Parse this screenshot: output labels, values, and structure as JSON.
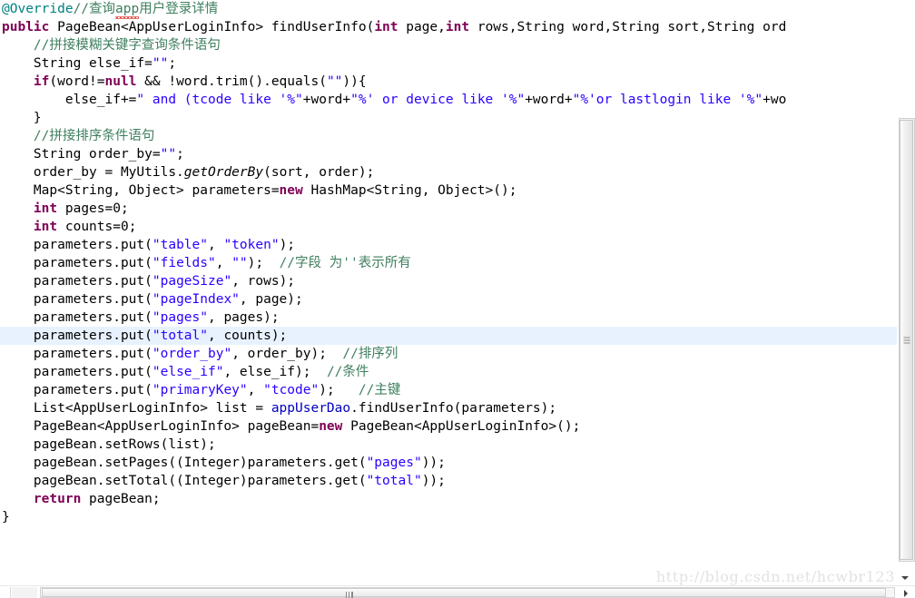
{
  "editor": {
    "language": "java",
    "colors": {
      "keyword": "#7F0055",
      "string": "#2A00FF",
      "comment": "#3F7F5F",
      "annotation": "#646464",
      "field": "#0000C0",
      "current_line_highlight": "#E8F2FE",
      "background": "#FFFFFF",
      "foreground": "#000000"
    },
    "current_line_index": 20,
    "lines": [
      {
        "index": 0,
        "indent": 0,
        "highlighted": false,
        "tokens": [
          {
            "t": "annotation",
            "v": "@Override"
          },
          {
            "t": "comment",
            "v": "//查询"
          },
          {
            "t": "comment-misspelled",
            "v": "app"
          },
          {
            "t": "comment",
            "v": "用户登录详情"
          }
        ]
      },
      {
        "index": 1,
        "indent": 0,
        "highlighted": false,
        "tokens": [
          {
            "t": "keyword",
            "v": "public"
          },
          {
            "t": "plain",
            "v": " PageBean<AppUserLoginInfo> findUserInfo("
          },
          {
            "t": "keyword",
            "v": "int"
          },
          {
            "t": "plain",
            "v": " page,"
          },
          {
            "t": "keyword",
            "v": "int"
          },
          {
            "t": "plain",
            "v": " rows,String word,String sort,String ord"
          }
        ]
      },
      {
        "index": 2,
        "indent": 1,
        "highlighted": false,
        "tokens": [
          {
            "t": "comment",
            "v": "//拼接模糊关键字查询条件语句"
          }
        ]
      },
      {
        "index": 3,
        "indent": 1,
        "highlighted": false,
        "tokens": [
          {
            "t": "plain",
            "v": "String else_if="
          },
          {
            "t": "string",
            "v": "\"\""
          },
          {
            "t": "plain",
            "v": ";"
          }
        ]
      },
      {
        "index": 4,
        "indent": 1,
        "highlighted": false,
        "tokens": [
          {
            "t": "keyword",
            "v": "if"
          },
          {
            "t": "plain",
            "v": "(word!="
          },
          {
            "t": "keyword",
            "v": "null"
          },
          {
            "t": "plain",
            "v": " && !word.trim().equals("
          },
          {
            "t": "string",
            "v": "\"\""
          },
          {
            "t": "plain",
            "v": ")){"
          }
        ]
      },
      {
        "index": 5,
        "indent": 2,
        "highlighted": false,
        "tokens": [
          {
            "t": "plain",
            "v": "else_if+="
          },
          {
            "t": "string",
            "v": "\" and (tcode like '%\""
          },
          {
            "t": "plain",
            "v": "+word+"
          },
          {
            "t": "string",
            "v": "\"%' or device like '%\""
          },
          {
            "t": "plain",
            "v": "+word+"
          },
          {
            "t": "string",
            "v": "\"%'or lastlogin like '%\""
          },
          {
            "t": "plain",
            "v": "+wo"
          }
        ]
      },
      {
        "index": 6,
        "indent": 1,
        "highlighted": false,
        "tokens": [
          {
            "t": "plain",
            "v": "}"
          }
        ]
      },
      {
        "index": 7,
        "indent": 1,
        "highlighted": false,
        "tokens": [
          {
            "t": "comment",
            "v": "//拼接排序条件语句"
          }
        ]
      },
      {
        "index": 8,
        "indent": 1,
        "highlighted": false,
        "tokens": [
          {
            "t": "plain",
            "v": "String order_by="
          },
          {
            "t": "string",
            "v": "\"\""
          },
          {
            "t": "plain",
            "v": ";"
          }
        ]
      },
      {
        "index": 9,
        "indent": 1,
        "highlighted": false,
        "tokens": [
          {
            "t": "plain",
            "v": "order_by = MyUtils."
          },
          {
            "t": "static-method",
            "v": "getOrderBy"
          },
          {
            "t": "plain",
            "v": "(sort, order);"
          }
        ]
      },
      {
        "index": 10,
        "indent": 1,
        "highlighted": false,
        "tokens": [
          {
            "t": "plain",
            "v": "Map<String, Object> parameters="
          },
          {
            "t": "keyword",
            "v": "new"
          },
          {
            "t": "plain",
            "v": " HashMap<String, Object>();"
          }
        ]
      },
      {
        "index": 11,
        "indent": 1,
        "highlighted": false,
        "tokens": [
          {
            "t": "keyword",
            "v": "int"
          },
          {
            "t": "plain",
            "v": " pages=0;"
          }
        ]
      },
      {
        "index": 12,
        "indent": 1,
        "highlighted": false,
        "tokens": [
          {
            "t": "keyword",
            "v": "int"
          },
          {
            "t": "plain",
            "v": " counts=0;"
          }
        ]
      },
      {
        "index": 13,
        "indent": 1,
        "highlighted": false,
        "tokens": [
          {
            "t": "plain",
            "v": "parameters.put("
          },
          {
            "t": "string",
            "v": "\"table\""
          },
          {
            "t": "plain",
            "v": ", "
          },
          {
            "t": "string",
            "v": "\"token\""
          },
          {
            "t": "plain",
            "v": ");"
          }
        ]
      },
      {
        "index": 14,
        "indent": 1,
        "highlighted": false,
        "tokens": [
          {
            "t": "plain",
            "v": "parameters.put("
          },
          {
            "t": "string",
            "v": "\"fields\""
          },
          {
            "t": "plain",
            "v": ", "
          },
          {
            "t": "string",
            "v": "\"\""
          },
          {
            "t": "plain",
            "v": ");  "
          },
          {
            "t": "comment",
            "v": "//字段 为''表示所有"
          }
        ]
      },
      {
        "index": 15,
        "indent": 1,
        "highlighted": false,
        "tokens": [
          {
            "t": "plain",
            "v": "parameters.put("
          },
          {
            "t": "string",
            "v": "\"pageSize\""
          },
          {
            "t": "plain",
            "v": ", rows);"
          }
        ]
      },
      {
        "index": 16,
        "indent": 1,
        "highlighted": false,
        "tokens": [
          {
            "t": "plain",
            "v": "parameters.put("
          },
          {
            "t": "string",
            "v": "\"pageIndex\""
          },
          {
            "t": "plain",
            "v": ", page);"
          }
        ]
      },
      {
        "index": 17,
        "indent": 1,
        "highlighted": false,
        "tokens": [
          {
            "t": "plain",
            "v": "parameters.put("
          },
          {
            "t": "string",
            "v": "\"pages\""
          },
          {
            "t": "plain",
            "v": ", pages);"
          }
        ]
      },
      {
        "index": 18,
        "indent": 1,
        "highlighted": true,
        "tokens": [
          {
            "t": "plain",
            "v": "parameters.put("
          },
          {
            "t": "string",
            "v": "\"total\""
          },
          {
            "t": "plain",
            "v": ", counts);"
          }
        ]
      },
      {
        "index": 19,
        "indent": 1,
        "highlighted": false,
        "tokens": [
          {
            "t": "plain",
            "v": "parameters.put("
          },
          {
            "t": "string",
            "v": "\"order_by\""
          },
          {
            "t": "plain",
            "v": ", order_by);  "
          },
          {
            "t": "comment",
            "v": "//排序列"
          }
        ]
      },
      {
        "index": 20,
        "indent": 1,
        "highlighted": false,
        "tokens": [
          {
            "t": "plain",
            "v": "parameters.put("
          },
          {
            "t": "string",
            "v": "\"else_if\""
          },
          {
            "t": "plain",
            "v": ", else_if);  "
          },
          {
            "t": "comment",
            "v": "//条件"
          }
        ]
      },
      {
        "index": 21,
        "indent": 1,
        "highlighted": false,
        "tokens": [
          {
            "t": "plain",
            "v": "parameters.put("
          },
          {
            "t": "string",
            "v": "\"primaryKey\""
          },
          {
            "t": "plain",
            "v": ", "
          },
          {
            "t": "string",
            "v": "\"tcode\""
          },
          {
            "t": "plain",
            "v": ");   "
          },
          {
            "t": "comment",
            "v": "//主键"
          }
        ]
      },
      {
        "index": 22,
        "indent": 1,
        "highlighted": false,
        "tokens": [
          {
            "t": "plain",
            "v": "List<AppUserLoginInfo> list = "
          },
          {
            "t": "field",
            "v": "appUserDao"
          },
          {
            "t": "plain",
            "v": ".findUserInfo(parameters);"
          }
        ]
      },
      {
        "index": 23,
        "indent": 1,
        "highlighted": false,
        "tokens": [
          {
            "t": "plain",
            "v": "PageBean<AppUserLoginInfo> pageBean="
          },
          {
            "t": "keyword",
            "v": "new"
          },
          {
            "t": "plain",
            "v": " PageBean<AppUserLoginInfo>();"
          }
        ]
      },
      {
        "index": 24,
        "indent": 1,
        "highlighted": false,
        "tokens": [
          {
            "t": "plain",
            "v": "pageBean.setRows(list);"
          }
        ]
      },
      {
        "index": 25,
        "indent": 1,
        "highlighted": false,
        "tokens": [
          {
            "t": "plain",
            "v": "pageBean.setPages((Integer)parameters.get("
          },
          {
            "t": "string",
            "v": "\"pages\""
          },
          {
            "t": "plain",
            "v": "));"
          }
        ]
      },
      {
        "index": 26,
        "indent": 1,
        "highlighted": false,
        "tokens": [
          {
            "t": "plain",
            "v": "pageBean.setTotal((Integer)parameters.get("
          },
          {
            "t": "string",
            "v": "\"total\""
          },
          {
            "t": "plain",
            "v": "));"
          }
        ]
      },
      {
        "index": 27,
        "indent": 1,
        "highlighted": false,
        "tokens": [
          {
            "t": "keyword",
            "v": "return"
          },
          {
            "t": "plain",
            "v": " pageBean;"
          }
        ]
      },
      {
        "index": 28,
        "indent": 0,
        "highlighted": false,
        "tokens": [
          {
            "t": "plain",
            "v": "}"
          }
        ]
      }
    ]
  },
  "watermark": {
    "text": "http://blog.csdn.net/hcwbr123"
  },
  "scrollbars": {
    "vertical": {
      "icon": "scrollbar-grip-icon",
      "down_arrow_icon": "chevron-down-icon"
    },
    "horizontal": {
      "icon": "scrollbar-grip-icon",
      "right_arrow_icon": "chevron-right-icon"
    }
  }
}
